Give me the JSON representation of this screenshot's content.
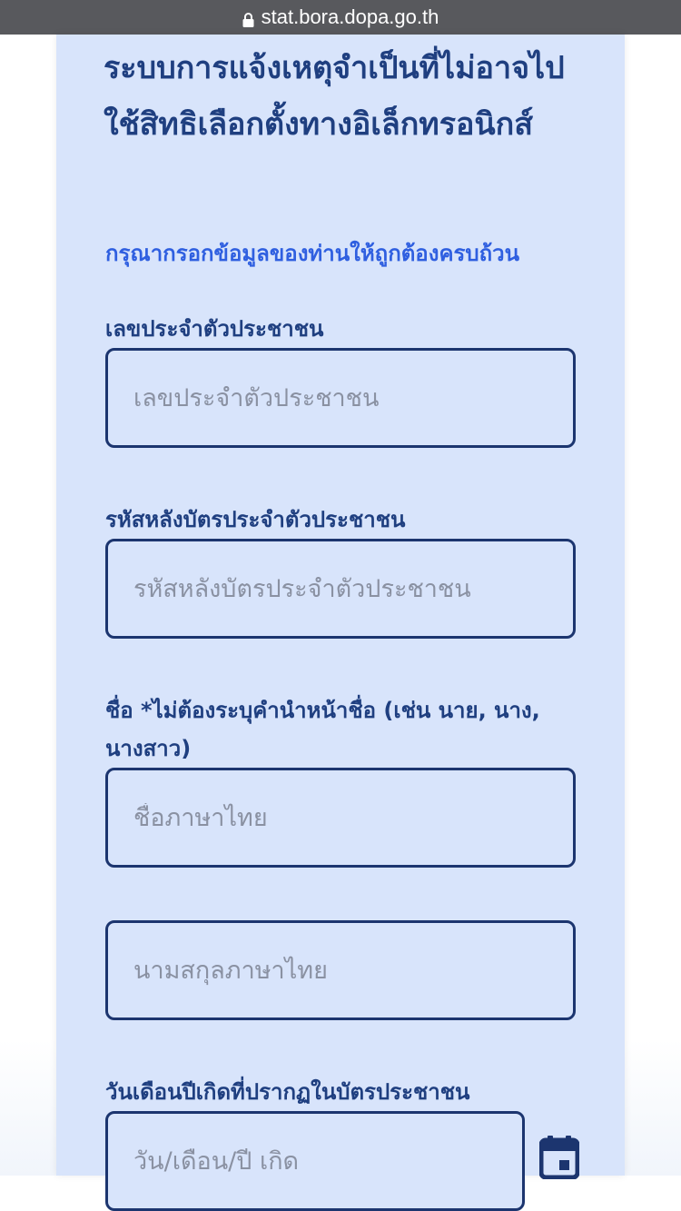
{
  "browser": {
    "url": "stat.bora.dopa.go.th",
    "lock_icon": "lock-icon"
  },
  "colors": {
    "card_bg": "#d8e4fb",
    "title": "#1f3f80",
    "notice": "#2f5fe0",
    "border": "#1c356f",
    "placeholder": "#8a91a2"
  },
  "form": {
    "title": "ระบบการแจ้งเหตุจำเป็นที่ไม่อาจไปใช้สิทธิเลือกตั้งทางอิเล็กทรอนิกส์",
    "notice": "กรุณากรอกข้อมูลของท่านให้ถูกต้องครบถ้วน",
    "id_card": {
      "label": "เลขประจำตัวประชาชน",
      "placeholder": "เลขประจำตัวประชาชน"
    },
    "laser_code": {
      "label": "รหัสหลังบัตรประจำตัวประชาชน",
      "placeholder": "รหัสหลังบัตรประจำตัวประชาชน"
    },
    "name": {
      "label": "ชื่อ *ไม่ต้องระบุคำนำหน้าชื่อ (เช่น นาย, นาง, นางสาว)",
      "first_placeholder": "ชื่อภาษาไทย",
      "last_placeholder": "นามสกุลภาษาไทย"
    },
    "birthdate": {
      "label": "วันเดือนปีเกิดที่ปรากฏในบัตรประชาชน",
      "placeholder": "วัน/เดือน/ปี เกิด",
      "icon": "calendar-icon"
    }
  }
}
